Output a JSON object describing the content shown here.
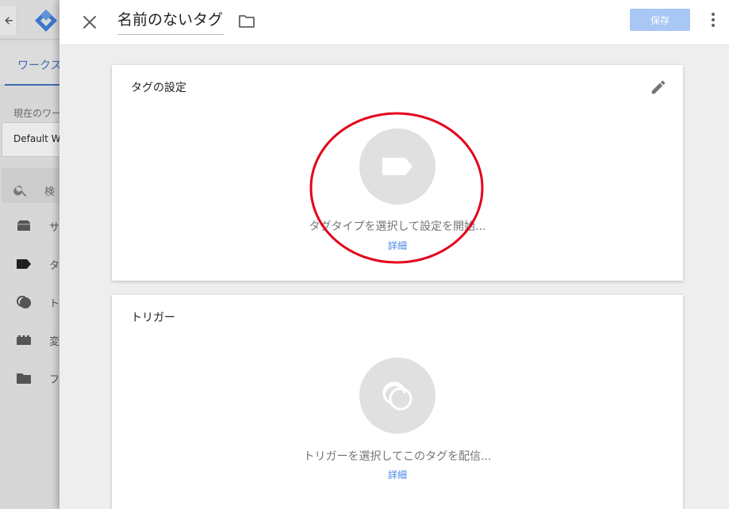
{
  "background": {
    "nav_tab_label": "ワークス",
    "workspace_label": "現在のワー",
    "workspace_value": "Default Wo",
    "search_label": "検",
    "nav_items": [
      {
        "icon": "overview-icon",
        "label": "サ"
      },
      {
        "icon": "tag-icon",
        "label": "タ"
      },
      {
        "icon": "trigger-icon",
        "label": "ト"
      },
      {
        "icon": "variables-icon",
        "label": "変"
      },
      {
        "icon": "folder-icon",
        "label": "フ"
      }
    ]
  },
  "header": {
    "title": "名前のないタグ",
    "save_label": "保存"
  },
  "tag_card": {
    "title": "タグの設定",
    "prompt": "タグタイプを選択して設定を開始...",
    "detail": "詳細"
  },
  "trigger_card": {
    "title": "トリガー",
    "prompt": "トリガーを選択してこのタグを配信...",
    "detail": "詳細"
  },
  "colors": {
    "accent": "#4a86e8",
    "save_disabled": "#a8c7f5",
    "annotation": "#e4001b"
  }
}
